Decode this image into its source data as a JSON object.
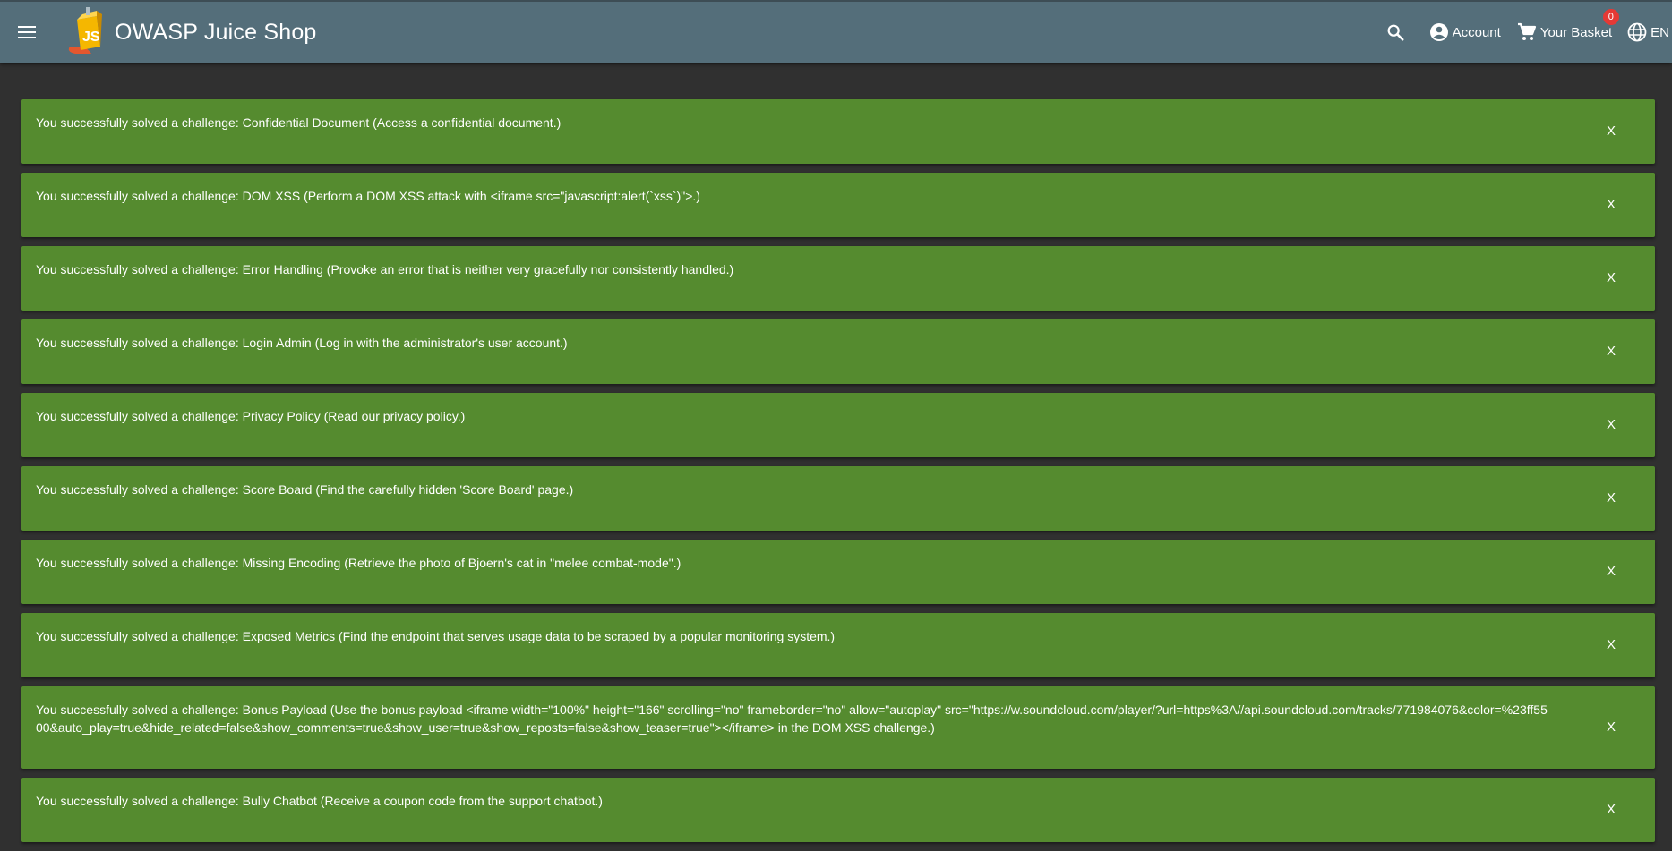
{
  "header": {
    "title": "OWASP Juice Shop",
    "account_label": "Account",
    "basket_label": "Your Basket",
    "basket_count": "0",
    "language_label": "EN",
    "icons": {
      "menu": "menu-icon",
      "logo": "juice-shop-logo",
      "search": "search-icon",
      "account": "account-circle-icon",
      "basket": "shopping-cart-icon",
      "language": "globe-icon"
    }
  },
  "notifications": [
    {
      "message": "You successfully solved a challenge: Confidential Document (Access a confidential document.)",
      "close": "X"
    },
    {
      "message": "You successfully solved a challenge: DOM XSS (Perform a DOM XSS attack with <iframe src=\"javascript:alert(`xss`)\">.)",
      "close": "X"
    },
    {
      "message": "You successfully solved a challenge: Error Handling (Provoke an error that is neither very gracefully nor consistently handled.)",
      "close": "X"
    },
    {
      "message": "You successfully solved a challenge: Login Admin (Log in with the administrator's user account.)",
      "close": "X"
    },
    {
      "message": "You successfully solved a challenge: Privacy Policy (Read our privacy policy.)",
      "close": "X"
    },
    {
      "message": "You successfully solved a challenge: Score Board (Find the carefully hidden 'Score Board' page.)",
      "close": "X"
    },
    {
      "message": "You successfully solved a challenge: Missing Encoding (Retrieve the photo of Bjoern's cat in \"melee combat-mode\".)",
      "close": "X"
    },
    {
      "message": "You successfully solved a challenge: Exposed Metrics (Find the endpoint that serves usage data to be scraped by a popular monitoring system.)",
      "close": "X"
    },
    {
      "message": "You successfully solved a challenge: Bonus Payload (Use the bonus payload <iframe width=\"100%\" height=\"166\" scrolling=\"no\" frameborder=\"no\" allow=\"autoplay\" src=\"https://w.soundcloud.com/player/?url=https%3A//api.soundcloud.com/tracks/771984076&color=%23ff5500&auto_play=true&hide_related=false&show_comments=true&show_user=true&show_reposts=false&show_teaser=true\"></iframe> in the DOM XSS challenge.)",
      "close": "X"
    },
    {
      "message": "You successfully solved a challenge: Bully Chatbot (Receive a coupon code from the support chatbot.)",
      "close": "X"
    }
  ],
  "colors": {
    "toolbar": "#546e7a",
    "background": "#303030",
    "notification": "#558b2f",
    "badge": "#e53935"
  }
}
